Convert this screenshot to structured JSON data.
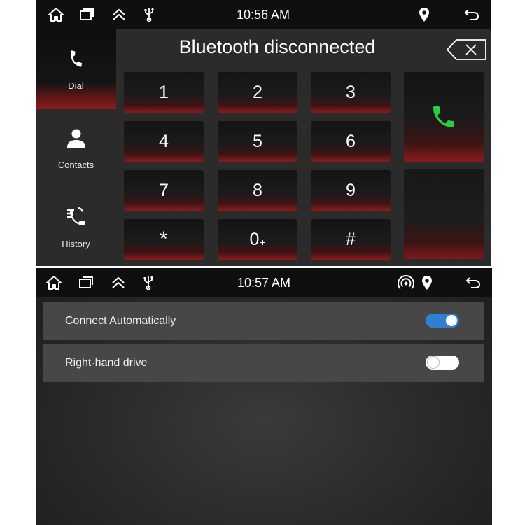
{
  "dialer_screen": {
    "status_bar": {
      "time": "10:56 AM",
      "left_icons": [
        "home-icon",
        "recent-apps-icon",
        "chevron-up-icon",
        "usb-icon"
      ],
      "right_icons": [
        "location-pin-icon",
        "back-icon"
      ]
    },
    "title": "Bluetooth disconnected",
    "nav": [
      {
        "label": "Dial",
        "icon": "phone-icon",
        "active": true
      },
      {
        "label": "Contacts",
        "icon": "person-icon",
        "active": false
      },
      {
        "label": "History",
        "icon": "call-history-icon",
        "active": false
      }
    ],
    "keypad": {
      "keys": [
        "1",
        "2",
        "3",
        "4",
        "5",
        "6",
        "7",
        "8",
        "9",
        "*",
        "0",
        "#"
      ],
      "zero_suffix": "+"
    },
    "call_button_icon": "green-phone-icon",
    "call_button_color": "#2ecc40",
    "backspace_icon": "backspace-icon"
  },
  "settings_screen": {
    "status_bar": {
      "time": "10:57 AM",
      "left_icons": [
        "home-icon",
        "recent-apps-icon",
        "chevron-up-icon",
        "usb-icon"
      ],
      "right_icons": [
        "hotspot-icon",
        "location-pin-icon",
        "back-icon"
      ]
    },
    "settings": [
      {
        "label": "Connect Automatically",
        "enabled": true
      },
      {
        "label": "Right-hand drive",
        "enabled": false
      }
    ],
    "toggle_on_color": "#2f7fd4"
  }
}
